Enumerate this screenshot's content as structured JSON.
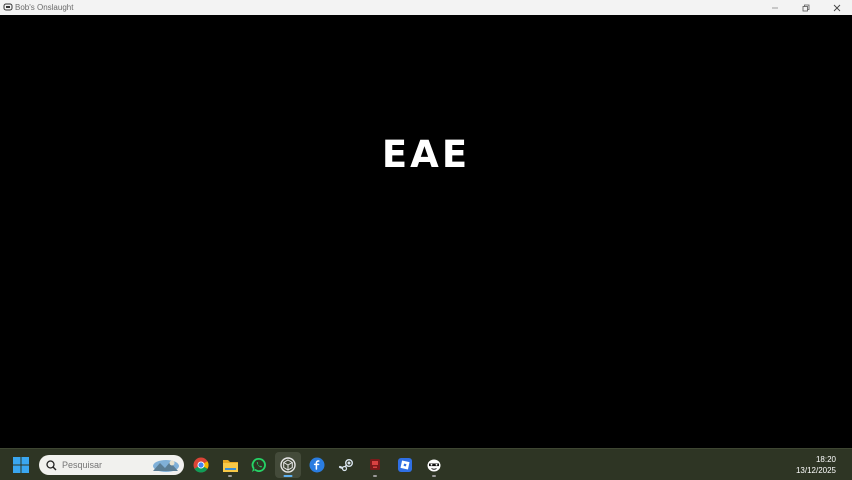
{
  "window": {
    "title": "Bob's Onslaught",
    "controls": {
      "minimize_icon": "minimize-icon",
      "restore_icon": "restore-icon",
      "close_icon": "close-icon"
    }
  },
  "game": {
    "text": "EAE",
    "background": "#000000",
    "text_color": "#ffffff"
  },
  "taskbar": {
    "background": "#2e3524",
    "search": {
      "placeholder": "Pesquisar"
    },
    "apps": [
      {
        "name": "chrome",
        "icon": "chrome-icon",
        "running": false
      },
      {
        "name": "file-explorer",
        "icon": "folder-icon",
        "running": true
      },
      {
        "name": "whatsapp",
        "icon": "whatsapp-icon",
        "running": false
      },
      {
        "name": "unity",
        "icon": "unity-icon",
        "running": true,
        "active": true
      },
      {
        "name": "fl-studio-mobile",
        "icon": "f-app-icon",
        "running": false
      },
      {
        "name": "steam",
        "icon": "steam-icon",
        "running": false
      },
      {
        "name": "game-app",
        "icon": "red-app-icon",
        "running": true
      },
      {
        "name": "roblox",
        "icon": "roblox-icon",
        "running": false
      },
      {
        "name": "bob-game",
        "icon": "bob-face-icon",
        "running": true
      }
    ],
    "clock": {
      "time": "18:20",
      "date": "13/12/2025"
    }
  }
}
